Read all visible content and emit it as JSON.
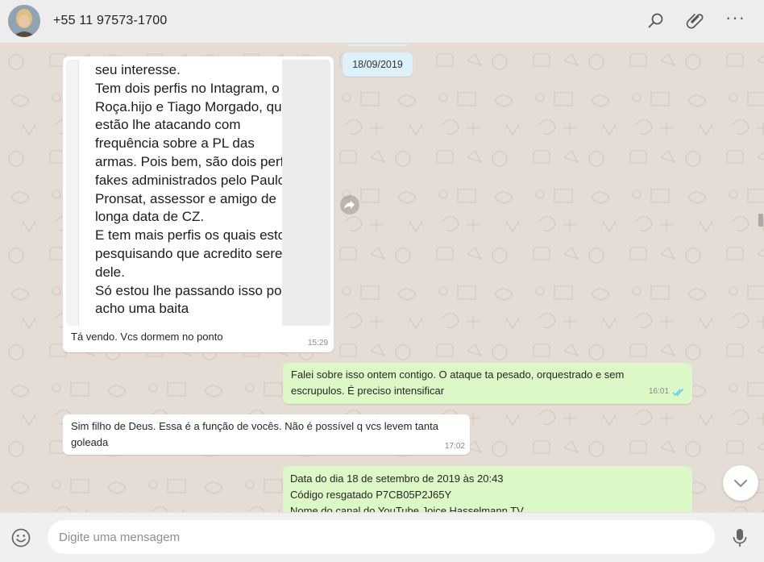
{
  "header": {
    "contact_name": "+55 11 97573-1700",
    "more_label": "···"
  },
  "chat": {
    "date_pill": "18/09/2019",
    "messages": [
      {
        "direction": "in",
        "type": "image",
        "image_text": "seu interesse.\nTem dois perfis no Intagram, o Roça.hijo e Tiago Morgado, que estão lhe atacando com frequência sobre a PL das armas. Pois bem, são dois perfis fakes administrados pelo Paulo Pronsat, assessor e amigo de longa data de CZ.\nE tem mais perfis os quais estou pesquisando que acredito serem dele.\nSó estou lhe passando isso pois acho uma baita",
        "caption": "Tá vendo. Vcs dormem no ponto",
        "time": "15:29"
      },
      {
        "direction": "out",
        "type": "text",
        "text": "Falei sobre isso ontem contigo. O ataque ta pesado, orquestrado e sem escrupulos. É preciso intensificar",
        "time": "16:01",
        "status": "read"
      },
      {
        "direction": "in",
        "type": "text",
        "text": "Sim filho de Deus. Essa é a função de vocês. Não é possível q vcs levem tanta goleada",
        "time": "17:02"
      },
      {
        "direction": "out",
        "type": "text",
        "lines": [
          "Data do dia 18 de setembro de 2019 às 20:43",
          "Código resgatado P7CB05P2J65Y",
          "Nome do canal do YouTube Joice Hasselmann TV"
        ]
      }
    ]
  },
  "composer": {
    "placeholder": "Digite uma mensagem"
  },
  "colors": {
    "chat_bg": "#e5ddd5",
    "incoming": "#ffffff",
    "outgoing": "#dcf8c6",
    "date_pill": "#dcf1fb",
    "read_ticks": "#4fc3f7"
  },
  "icons": [
    "search-icon",
    "attach-icon",
    "menu-icon",
    "forward-icon",
    "double-check-icon",
    "chevron-down-icon",
    "emoji-icon",
    "mic-icon"
  ]
}
